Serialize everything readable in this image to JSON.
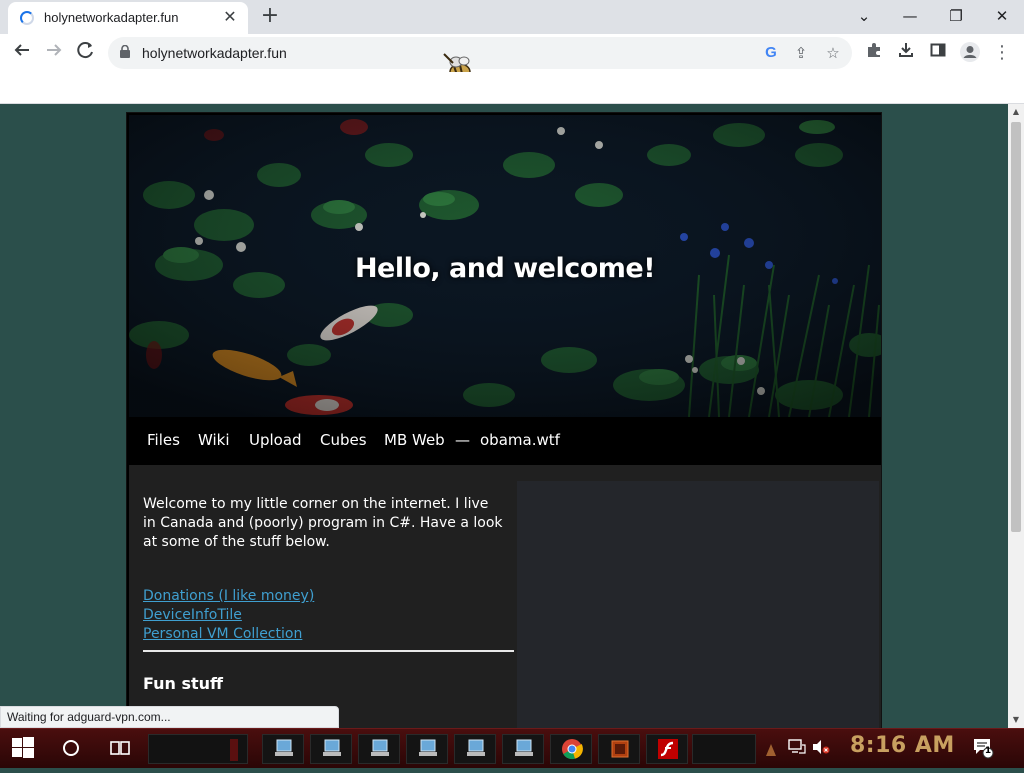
{
  "browser": {
    "tab_title": "holynetworkadapter.fun",
    "url": "holynetworkadapter.fun",
    "status_text": "Waiting for adguard-vpn.com..."
  },
  "site": {
    "hero_title": "Hello, and welcome!",
    "nav": [
      "Files",
      "Wiki",
      "Upload",
      "Cubes",
      "MB Web",
      "obama.wtf"
    ],
    "nav_separator": "—",
    "intro": "Welcome to my little corner on the internet. I live in Canada and (poorly) program in C#. Have a look at some of the stuff below.",
    "links": [
      "Donations (I like money)",
      "DeviceInfoTile",
      "Personal VM Collection"
    ],
    "section_heading": "Fun stuff"
  },
  "taskbar": {
    "clock": "8:16 AM",
    "notification_count": "1"
  },
  "colors": {
    "page_background": "#2b4f4b",
    "link": "#3f9fd0",
    "taskbar": "#3a0a0a",
    "clock": "#c8a060"
  },
  "icons": [
    "back-icon",
    "forward-icon",
    "stop-icon",
    "lock-icon",
    "google-icon",
    "share-icon",
    "star-icon",
    "extensions-icon",
    "download-icon",
    "sidepanel-icon",
    "profile-icon",
    "menu-icon",
    "windows-start-icon",
    "cortana-icon",
    "task-view-icon",
    "chrome-icon",
    "flash-icon"
  ]
}
